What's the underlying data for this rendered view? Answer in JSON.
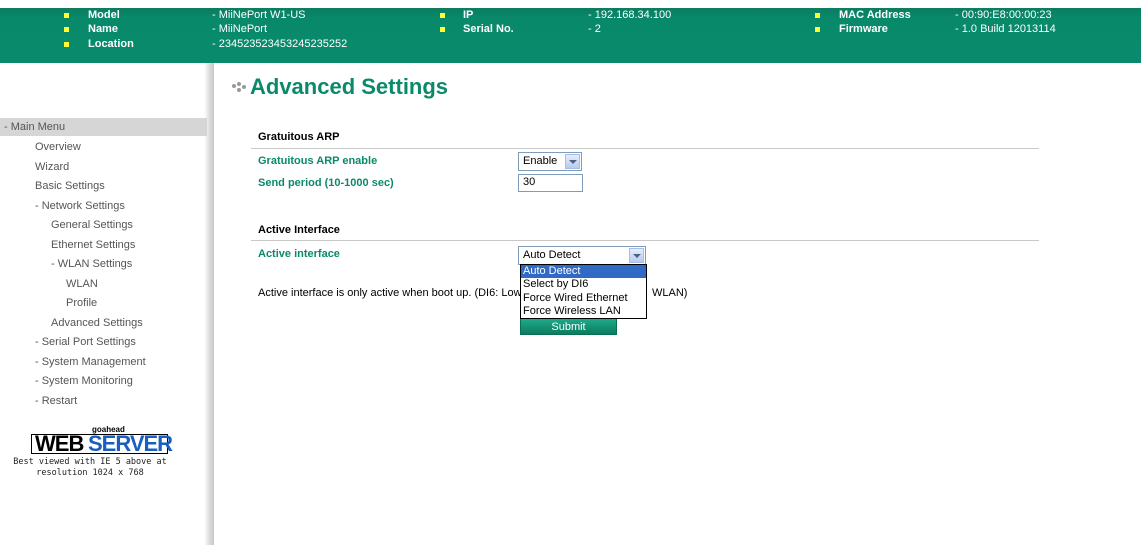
{
  "header": {
    "left": [
      {
        "label": "Model",
        "value": "- MiiNePort W1-US"
      },
      {
        "label": "Name",
        "value": "- MiiNePort"
      },
      {
        "label": "Location",
        "value": "- 234523523453245235252"
      }
    ],
    "middle": [
      {
        "label": "IP",
        "value": "- 192.168.34.100"
      },
      {
        "label": "Serial No.",
        "value": "- 2"
      }
    ],
    "right": [
      {
        "label": "MAC Address",
        "value": "- 00:90:E8:00:00:23"
      },
      {
        "label": "Firmware",
        "value": "- 1.0 Build 12013114"
      }
    ]
  },
  "sidebar": {
    "head": "- Main Menu",
    "items": [
      "Overview",
      "Wizard",
      "Basic Settings",
      "- Network Settings",
      "General Settings",
      "Ethernet Settings",
      "- WLAN Settings",
      "WLAN",
      "Profile",
      "Advanced Settings",
      "- Serial Port Settings",
      "- System Management",
      "- System Monitoring",
      "- Restart"
    ],
    "logo_small": "goahead",
    "logo_web": "WEB",
    "logo_server": "SERVER",
    "best_viewed_1": "Best viewed with IE 5 above at",
    "best_viewed_2": "resolution 1024 x 768"
  },
  "main": {
    "title": "Advanced Settings",
    "gratuitous": {
      "heading": "Gratuitous ARP",
      "enable_label": "Gratuitous ARP enable",
      "enable_value": "Enable",
      "period_label": "Send period (10-1000 sec)",
      "period_value": "30"
    },
    "active": {
      "heading": "Active Interface",
      "label": "Active interface",
      "value": "Auto Detect",
      "note_left": "Active interface is only active when boot up. (DI6: Low",
      "note_right": "WLAN)",
      "options": [
        "Auto Detect",
        "Select by DI6",
        "Force Wired Ethernet",
        "Force Wireless LAN"
      ],
      "selected_index": 0
    },
    "submit_label": "Submit"
  }
}
